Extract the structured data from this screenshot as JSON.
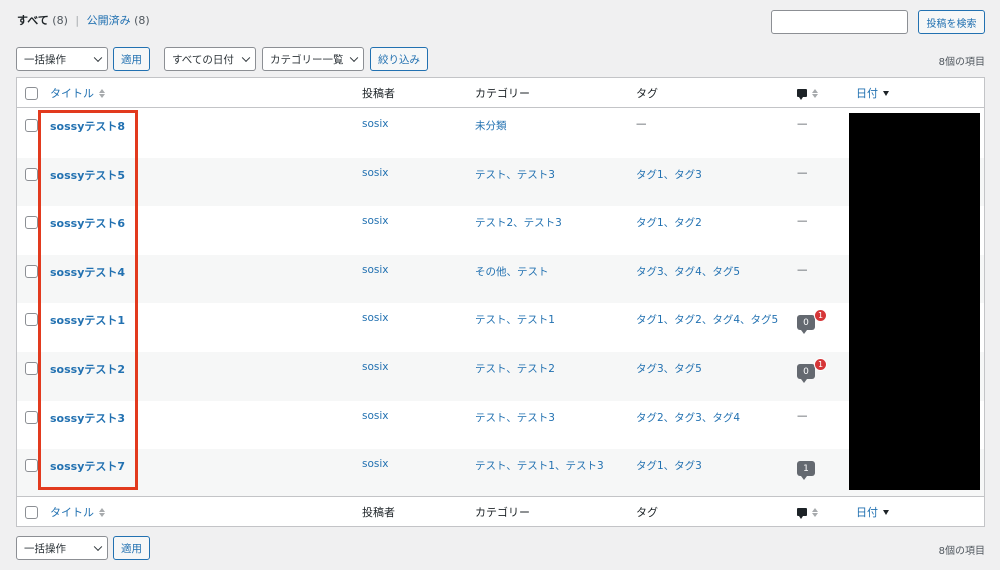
{
  "views": {
    "all_label": "すべて",
    "all_count": "(8)",
    "separator": "|",
    "published_label": "公開済み",
    "published_count": "(8)"
  },
  "search": {
    "value": "",
    "button_label": "投稿を検索"
  },
  "top_bar": {
    "bulk_action": "一括操作",
    "apply": "適用",
    "date_filter": "すべての日付",
    "category_filter": "カテゴリー一覧",
    "filter_button": "絞り込み",
    "items_count": "8個の項目"
  },
  "columns": {
    "title": "タイトル",
    "author": "投稿者",
    "categories": "カテゴリー",
    "tags": "タグ",
    "comments_icon": "comment-icon",
    "date": "日付"
  },
  "rows": [
    {
      "title": "sossyテスト8",
      "author": "sosix",
      "categories": "未分類",
      "tags": "—",
      "comments": {
        "type": "none",
        "text": "—"
      }
    },
    {
      "title": "sossyテスト5",
      "author": "sosix",
      "categories": "テスト、テスト3",
      "tags": "タグ1、タグ3",
      "comments": {
        "type": "none",
        "text": "—"
      }
    },
    {
      "title": "sossyテスト6",
      "author": "sosix",
      "categories": "テスト2、テスト3",
      "tags": "タグ1、タグ2",
      "comments": {
        "type": "none",
        "text": "—"
      }
    },
    {
      "title": "sossyテスト4",
      "author": "sosix",
      "categories": "その他、テスト",
      "tags": "タグ3、タグ4、タグ5",
      "comments": {
        "type": "none",
        "text": "—"
      }
    },
    {
      "title": "sossyテスト1",
      "author": "sosix",
      "categories": "テスト、テスト1",
      "tags": "タグ1、タグ2、タグ4、タグ5",
      "comments": {
        "type": "pending",
        "approved": "0",
        "pending": "1"
      }
    },
    {
      "title": "sossyテスト2",
      "author": "sosix",
      "categories": "テスト、テスト2",
      "tags": "タグ3、タグ5",
      "comments": {
        "type": "pending",
        "approved": "0",
        "pending": "1"
      }
    },
    {
      "title": "sossyテスト3",
      "author": "sosix",
      "categories": "テスト、テスト3",
      "tags": "タグ2、タグ3、タグ4",
      "comments": {
        "type": "none",
        "text": "—"
      }
    },
    {
      "title": "sossyテスト7",
      "author": "sosix",
      "categories": "テスト、テスト1、テスト3",
      "tags": "タグ1、タグ3",
      "comments": {
        "type": "approved",
        "approved": "1"
      }
    }
  ],
  "bottom_bar": {
    "bulk_action": "一括操作",
    "apply": "適用",
    "items_count": "8個の項目"
  },
  "colors": {
    "link": "#2271b1",
    "highlight_border": "#e23a1e",
    "redaction": "#000000",
    "pending_badge": "#d63638"
  }
}
